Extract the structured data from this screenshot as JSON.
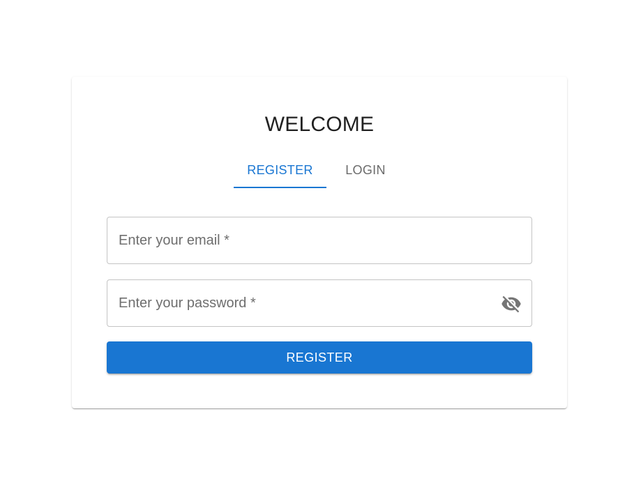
{
  "card": {
    "title": "WELCOME",
    "tabs": [
      {
        "label": "REGISTER",
        "active": true
      },
      {
        "label": "LOGIN",
        "active": false
      }
    ],
    "email": {
      "value": "",
      "placeholder": "Enter your email *"
    },
    "password": {
      "value": "",
      "placeholder": "Enter your password *",
      "toggle_icon": "visibility-off-icon"
    },
    "submit_label": "REGISTER"
  },
  "colors": {
    "primary": "#1976d2",
    "text": "#212121",
    "muted": "#6b6b6b",
    "border": "#c4c4c4"
  }
}
